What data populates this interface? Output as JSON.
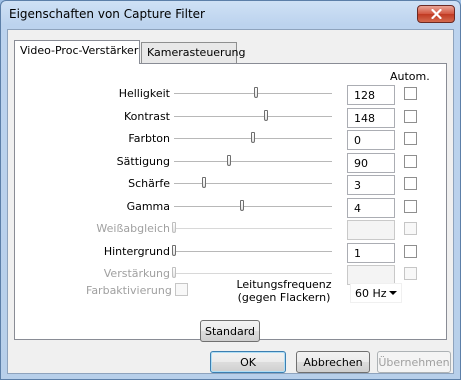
{
  "window": {
    "title": "Eigenschaften von Capture Filter"
  },
  "tabs": [
    {
      "label": "Video-Proc-Verstärker",
      "active": true
    },
    {
      "label": "Kamerasteuerung",
      "active": false
    }
  ],
  "autom_header": "Autom.",
  "controls": [
    {
      "label": "Helligkeit",
      "value": "128",
      "level": 0.52,
      "enabled": true,
      "auto": false
    },
    {
      "label": "Kontrast",
      "value": "148",
      "level": 0.58,
      "enabled": true,
      "auto": false
    },
    {
      "label": "Farbton",
      "value": "0",
      "level": 0.5,
      "enabled": true,
      "auto": false
    },
    {
      "label": "Sättigung",
      "value": "90",
      "level": 0.35,
      "enabled": true,
      "auto": false
    },
    {
      "label": "Schärfe",
      "value": "3",
      "level": 0.19,
      "enabled": true,
      "auto": false
    },
    {
      "label": "Gamma",
      "value": "4",
      "level": 0.43,
      "enabled": true,
      "auto": false
    },
    {
      "label": "Weißabgleich",
      "value": "",
      "level": 0.0,
      "enabled": false,
      "auto": false
    },
    {
      "label": "Hintergrund",
      "value": "1",
      "level": 0.0,
      "enabled": true,
      "auto": false
    },
    {
      "label": "Verstärkung",
      "value": "",
      "level": 0.0,
      "enabled": false,
      "auto": false
    }
  ],
  "color_enable": {
    "label": "Farbaktivierung",
    "enabled": false,
    "checked": false
  },
  "powerline": {
    "label_line1": "Leitungsfrequenz",
    "label_line2": "(gegen Flackern)",
    "selected": "60 Hz"
  },
  "buttons": {
    "default": "Standard",
    "ok": "OK",
    "cancel": "Abbrechen",
    "apply": "Übernehmen"
  }
}
